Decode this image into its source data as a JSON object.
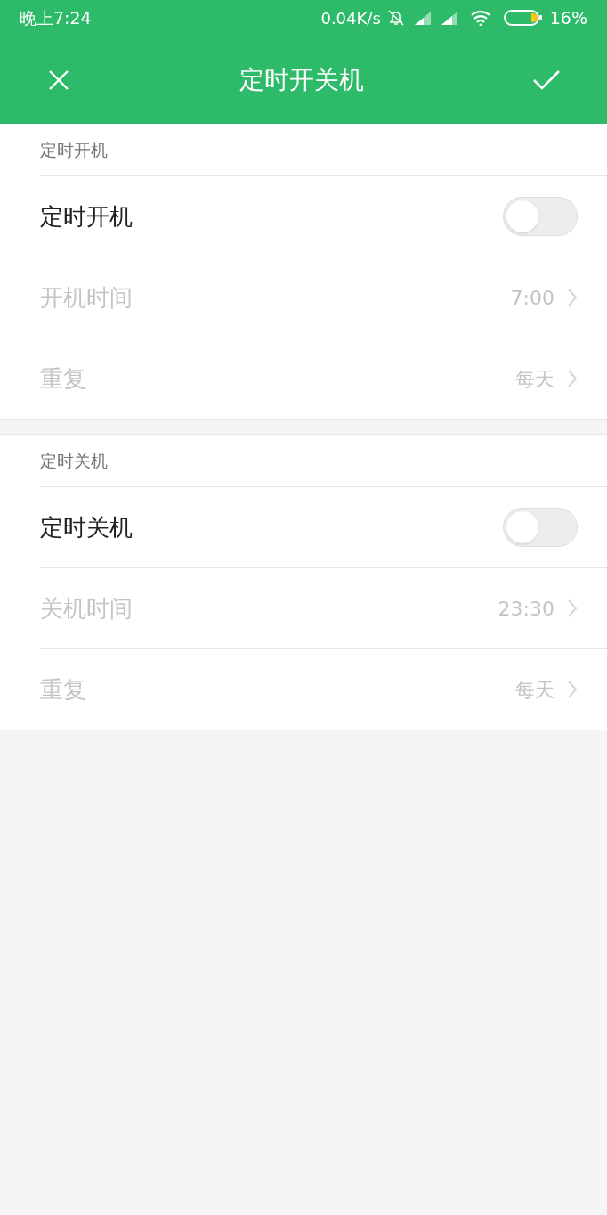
{
  "status_bar": {
    "time": "晚上7:24",
    "speed": "0.04K/s",
    "battery": "16%"
  },
  "header": {
    "title": "定时开关机"
  },
  "sections": [
    {
      "title": "定时开机",
      "rows": [
        {
          "kind": "switch",
          "label": "定时开机",
          "on": false
        },
        {
          "kind": "link",
          "label": "开机时间",
          "value": "7:00",
          "disabled": true
        },
        {
          "kind": "link",
          "label": "重复",
          "value": "每天",
          "disabled": true
        }
      ]
    },
    {
      "title": "定时关机",
      "rows": [
        {
          "kind": "switch",
          "label": "定时关机",
          "on": false
        },
        {
          "kind": "link",
          "label": "关机时间",
          "value": "23:30",
          "disabled": true
        },
        {
          "kind": "link",
          "label": "重复",
          "value": "每天",
          "disabled": true
        }
      ]
    }
  ]
}
